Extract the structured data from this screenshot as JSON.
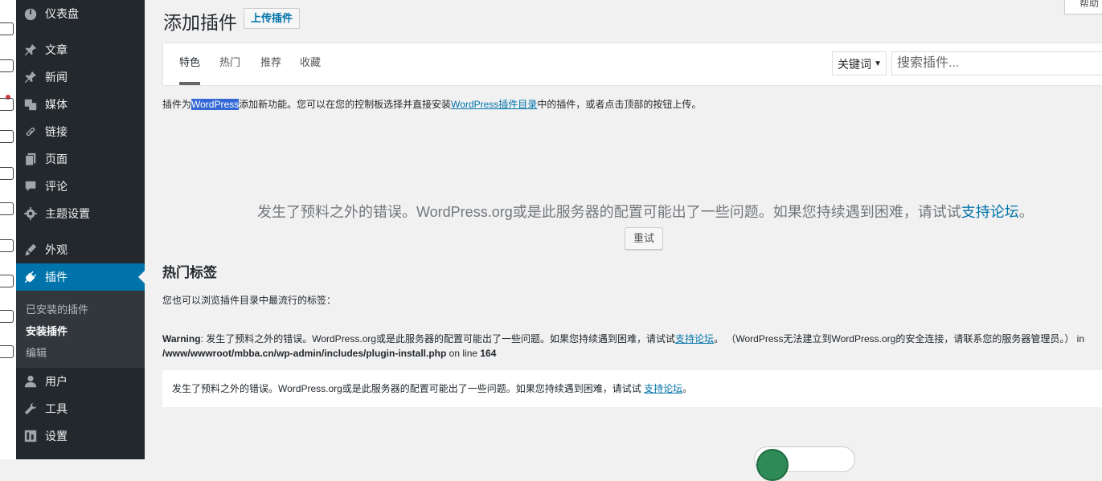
{
  "adminmenu": {
    "items": [
      {
        "label": "仪表盘",
        "icon": "dashboard-icon"
      },
      {
        "label": "文章",
        "icon": "pin-icon"
      },
      {
        "label": "新闻",
        "icon": "pin-icon"
      },
      {
        "label": "媒体",
        "icon": "media-icon"
      },
      {
        "label": "链接",
        "icon": "link-icon"
      },
      {
        "label": "页面",
        "icon": "page-icon"
      },
      {
        "label": "评论",
        "icon": "comment-icon"
      },
      {
        "label": "主题设置",
        "icon": "gear-icon"
      },
      {
        "label": "外观",
        "icon": "brush-icon"
      },
      {
        "label": "插件",
        "icon": "plugin-icon",
        "current": true
      },
      {
        "label": "用户",
        "icon": "user-icon"
      },
      {
        "label": "工具",
        "icon": "wrench-icon"
      },
      {
        "label": "设置",
        "icon": "settings-icon"
      }
    ],
    "submenu": [
      {
        "label": "已安装的插件"
      },
      {
        "label": "安装插件",
        "current": true
      },
      {
        "label": "编辑"
      }
    ]
  },
  "header": {
    "title": "添加插件",
    "upload_label": "上传插件",
    "help_label": "帮助"
  },
  "filter": {
    "tabs": [
      "特色",
      "热门",
      "推荐",
      "收藏"
    ],
    "search_type": "关键词",
    "search_placeholder": "搜索插件..."
  },
  "intro": {
    "before": "插件为",
    "highlight": "WordPress",
    "middle": "添加新功能。您可以在您的控制板选择并直接安装",
    "link": "WordPress插件目录",
    "after": "中的插件，或者点击顶部的按钮上传。"
  },
  "error": {
    "text": "发生了预料之外的错误。WordPress.org或是此服务器的配置可能出了一些问题。如果您持续遇到困难，请试试",
    "link": "支持论坛",
    "end": "。",
    "retry_label": "重试"
  },
  "tags": {
    "title": "热门标签",
    "desc": "您也可以浏览插件目录中最流行的标签："
  },
  "warning": {
    "label": "Warning",
    "text": ": 发生了预料之外的错误。WordPress.org或是此服务器的配置可能出了一些问题。如果您持续遇到困难，请试试",
    "link": "支持论坛",
    "text2": "。 （WordPress无法建立到WordPress.org的安全连接，请联系您的服务器管理员。） in ",
    "path": "/www/wwwroot/mbba.cn/wp-admin/includes/plugin-install.php",
    "online": " on line ",
    "line": "164"
  },
  "notice": {
    "text": "发生了预料之外的错误。WordPress.org或是此服务器的配置可能出了一些问题。如果您持续遇到困难，请试试 ",
    "link": "支持论坛",
    "end": "。"
  }
}
